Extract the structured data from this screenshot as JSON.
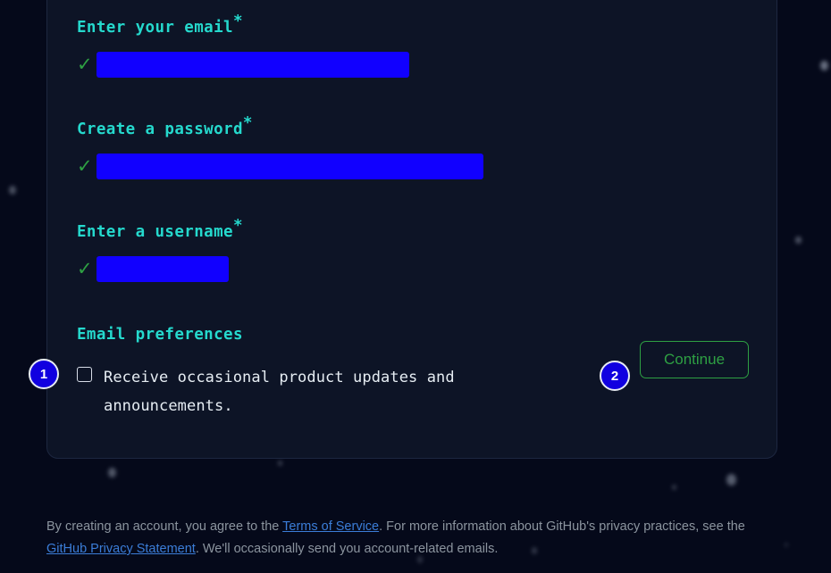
{
  "theme": {
    "page_bg": "#05091a",
    "card_bg": "#0d1426",
    "card_border": "#1d2740",
    "label_color": "#25d9cd",
    "check_color": "#2ea043",
    "redaction_color": "#1100ff",
    "accent_green": "#2ea043",
    "badge_blue": "#1100e0",
    "link_blue": "#3b7dd8",
    "muted_text": "#8b949e"
  },
  "form": {
    "fields": [
      {
        "label": "Enter your email",
        "required_marker": "*",
        "validity_icon": "check-icon",
        "validity_glyph": "✓",
        "value": "",
        "redacted": true
      },
      {
        "label": "Create a password",
        "required_marker": "*",
        "validity_icon": "check-icon",
        "validity_glyph": "✓",
        "value": "",
        "redacted": true
      },
      {
        "label": "Enter a username",
        "required_marker": "*",
        "validity_icon": "check-icon",
        "validity_glyph": "✓",
        "value": "",
        "redacted": true
      }
    ],
    "preferences": {
      "title": "Email preferences",
      "checkbox_icon": "checkbox-unchecked-icon",
      "checkbox_checked": false,
      "checkbox_label": "Receive occasional product updates and announcements."
    },
    "continue_button": {
      "label": "Continue"
    }
  },
  "annotations": [
    {
      "number": "1",
      "target": "email-preferences-checkbox"
    },
    {
      "number": "2",
      "target": "continue-button"
    }
  ],
  "legal": {
    "part1": "By creating an account, you agree to the ",
    "link1": "Terms of Service",
    "part2": ". For more information about GitHub's privacy practices, see the ",
    "link2": "GitHub Privacy Statement",
    "part3": ". We'll occasionally send you account-related emails."
  }
}
